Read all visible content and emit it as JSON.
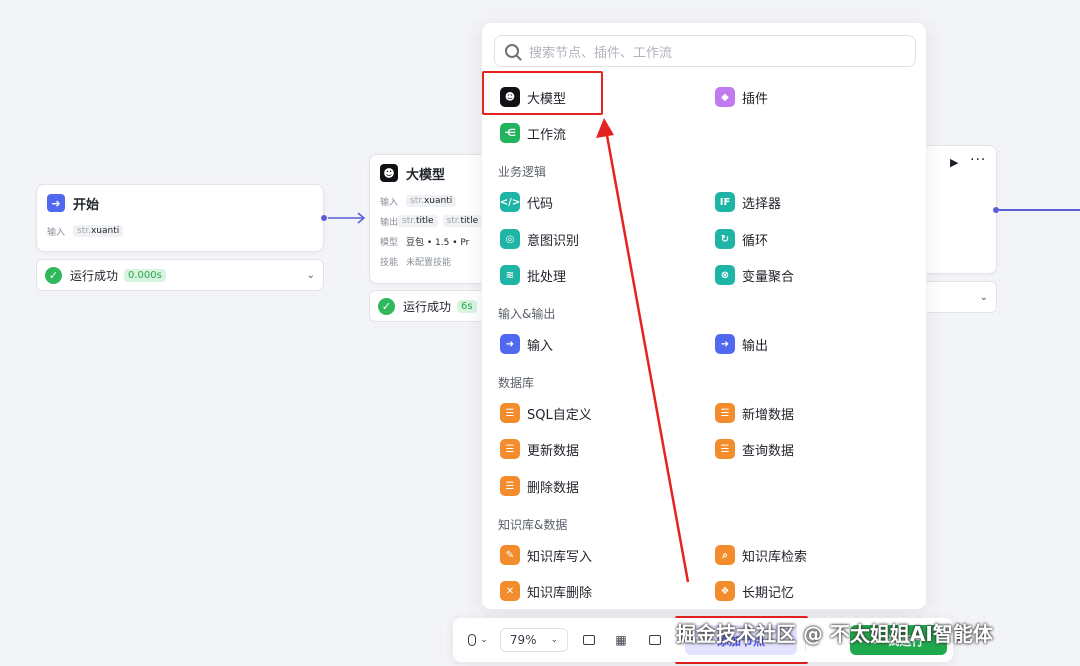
{
  "start_node": {
    "title": "开始",
    "input_label": "输入",
    "input_type": "str.",
    "input_value": "xuanti",
    "status_text": "运行成功",
    "status_time": "0.000s"
  },
  "llm_node": {
    "title": "大模型",
    "input_label": "输入",
    "input_type": "str.",
    "input_value": "xuanti",
    "output_label": "输出",
    "output_type": "str.",
    "output_value_1": "title",
    "output_value_2": "title",
    "model_label": "模型",
    "model_value": "豆包 • 1.5 • Pr",
    "skill_label": "技能",
    "skill_value": "未配置技能",
    "status_text": "运行成功",
    "status_time": "6s"
  },
  "right_node": {
    "run_icon": "play-icon",
    "more_icon": "more-icon"
  },
  "panel": {
    "search_placeholder": "搜索节点、插件、工作流",
    "top_items": [
      {
        "label": "大模型",
        "icon": "llm-icon"
      },
      {
        "label": "插件",
        "icon": "plugin-icon"
      },
      {
        "label": "工作流",
        "icon": "workflow-icon"
      }
    ],
    "sections": {
      "business_logic": "业务逻辑",
      "io": "输入&输出",
      "database": "数据库",
      "knowledge": "知识库&数据"
    },
    "business_items": [
      "代码",
      "选择器",
      "意图识别",
      "循环",
      "批处理",
      "变量聚合"
    ],
    "io_items": [
      "输入",
      "输出"
    ],
    "db_items": [
      "SQL自定义",
      "新增数据",
      "更新数据",
      "查询数据",
      "删除数据"
    ],
    "knowledge_items": [
      "知识库写入",
      "知识库检索",
      "知识库删除",
      "长期记忆"
    ]
  },
  "toolbar": {
    "zoom_value": "79%",
    "add_node_label": "添加节点",
    "run_label": "试运行"
  },
  "watermark": "掘金技术社区 @ 不太姐姐AI智能体",
  "colors": {
    "accent": "#4d53e8",
    "success": "#30b85c",
    "annotation_red": "#e6231f"
  }
}
